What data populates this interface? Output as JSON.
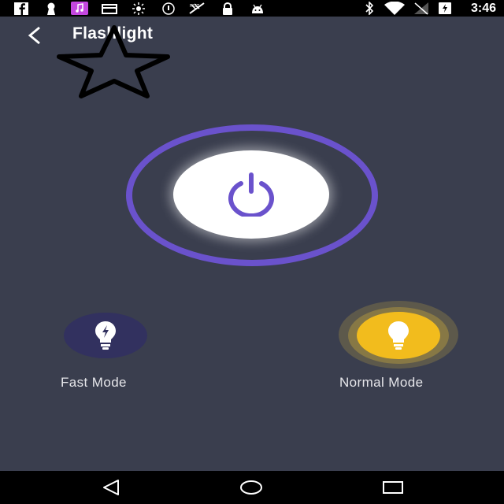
{
  "status_bar": {
    "time": "3:46",
    "icons_left": [
      "facebook-icon",
      "keyhole-icon",
      "music-app-icon",
      "card-icon",
      "sun-icon",
      "sync-icon",
      "no-signal-icon",
      "lock-icon",
      "android-icon"
    ],
    "icons_right": [
      "bluetooth-icon",
      "wifi-icon",
      "signal-icon",
      "battery-icon"
    ],
    "music_icon_color": "#c447e0"
  },
  "app_bar": {
    "title": "Flashlight",
    "back_icon": "back-arrow-icon"
  },
  "power": {
    "icon": "power-icon",
    "ring_color": "#6a52cc",
    "button_color": "#ffffff"
  },
  "modes": {
    "fast": {
      "label": "Fast Mode",
      "icon": "bulb-flash-icon",
      "color": "#32315f"
    },
    "normal": {
      "label": "Normal Mode",
      "icon": "bulb-icon",
      "color": "#f2bc1d"
    }
  },
  "nav_bar": {
    "buttons": [
      "back-triangle-icon",
      "home-circle-icon",
      "recents-square-icon"
    ]
  },
  "colors": {
    "background": "#3a3e4e",
    "accent": "#6a52cc"
  }
}
